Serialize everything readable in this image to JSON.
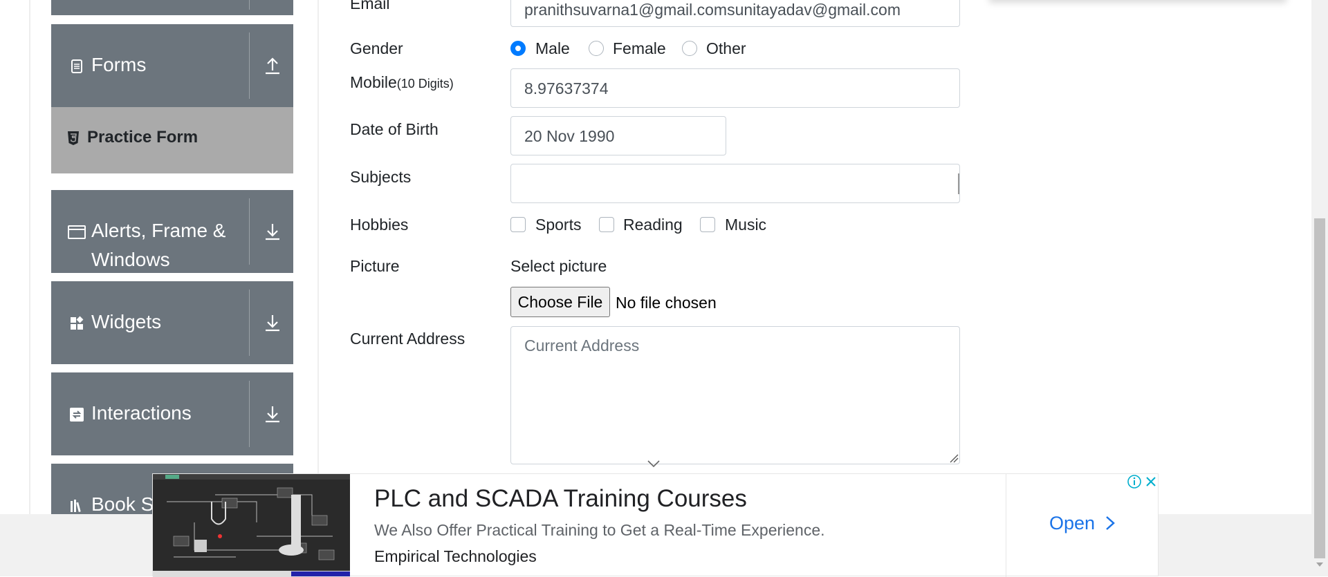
{
  "sidebar": {
    "groups": [
      {
        "label": "Forms",
        "icon": "document-icon",
        "state": "expanded"
      },
      {
        "label": "Alerts, Frame &",
        "label2": "Windows",
        "icon": "window-icon",
        "state": "collapsed"
      },
      {
        "label": "Widgets",
        "icon": "widgets-icon",
        "state": "collapsed"
      },
      {
        "label": "Interactions",
        "icon": "interactions-icon",
        "state": "collapsed"
      },
      {
        "label": "Book S",
        "icon": "books-icon",
        "state": "collapsed"
      }
    ],
    "sub_item": {
      "label": "Practice Form",
      "icon": "html5-icon"
    }
  },
  "form": {
    "email": {
      "label": "Email",
      "value": "pranithsuvarna1@gmail.comsunitayadav@gmail.com"
    },
    "gender": {
      "label": "Gender",
      "options": [
        "Male",
        "Female",
        "Other"
      ],
      "selected": "Male"
    },
    "mobile": {
      "label": "Mobile",
      "hint": "(10 Digits)",
      "value": "8.97637374"
    },
    "dob": {
      "label": "Date of Birth",
      "value": "20 Nov 1990"
    },
    "subjects": {
      "label": "Subjects",
      "value": ""
    },
    "hobbies": {
      "label": "Hobbies",
      "options": [
        "Sports",
        "Reading",
        "Music"
      ]
    },
    "picture": {
      "label": "Picture",
      "caption": "Select picture",
      "button": "Choose File",
      "status": "No file chosen"
    },
    "address": {
      "label": "Current Address",
      "placeholder": "Current Address"
    }
  },
  "ad": {
    "title": "PLC and SCADA Training Courses",
    "description": "We Also Offer Practical Training to Get a Real-Time Experience.",
    "advertiser": "Empirical Technologies",
    "cta": "Open",
    "colors": {
      "cta": "#1a73e8"
    }
  },
  "colors": {
    "sidebar_group": "#6c757d",
    "sidebar_active": "#aaaaaa",
    "radio_selected": "#007bff"
  }
}
